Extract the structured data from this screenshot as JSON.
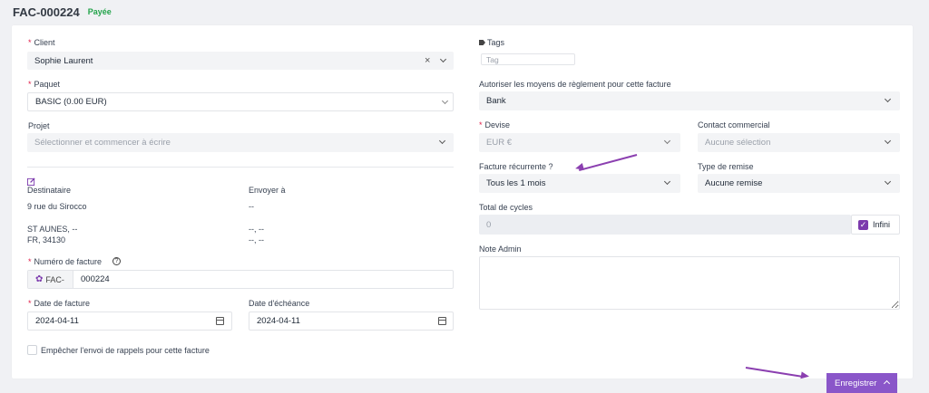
{
  "header": {
    "invoice_number": "FAC-000224",
    "status": "Payée",
    "status_color": "#22a34a"
  },
  "left": {
    "client": {
      "label": "Client",
      "value": "Sophie Laurent"
    },
    "package": {
      "label": "Paquet",
      "value": "BASIC (0.00 EUR)"
    },
    "project": {
      "label": "Projet",
      "placeholder": "Sélectionner et commencer à écrire"
    },
    "addresses": {
      "recipient_label": "Destinataire",
      "recipient_street": "9 rue du Sirocco",
      "recipient_city": "ST AUNES, --",
      "recipient_country": "FR, 34130",
      "send_to_label": "Envoyer à",
      "send_to_street": "--",
      "send_to_city": "--, --",
      "send_to_country": "--, --"
    },
    "invoice_number": {
      "label": "Numéro de facture",
      "prefix": "FAC-",
      "value": "000224"
    },
    "invoice_date": {
      "label": "Date de facture",
      "value": "2024-04-11"
    },
    "due_date": {
      "label": "Date d'échéance",
      "value": "2024-04-11"
    },
    "prevent_reminders": {
      "label": "Empêcher l'envoi de rappels pour cette facture",
      "checked": false
    }
  },
  "right": {
    "tags": {
      "label": "Tags",
      "placeholder": "Tag"
    },
    "payment_modes": {
      "label": "Autoriser les moyens de règlement pour cette facture",
      "value": "Bank"
    },
    "currency": {
      "label": "Devise",
      "value": "EUR €"
    },
    "sales_agent": {
      "label": "Contact commercial",
      "placeholder": "Aucune sélection"
    },
    "recurring": {
      "label": "Facture récurrente ?",
      "value": "Tous les 1 mois"
    },
    "discount_type": {
      "label": "Type de remise",
      "value": "Aucune remise"
    },
    "total_cycles": {
      "label": "Total de cycles",
      "value": "0",
      "infinite_label": "Infini",
      "infinite_checked": true
    },
    "admin_note": {
      "label": "Note Admin",
      "value": ""
    }
  },
  "footer": {
    "save_label": "Enregistrer"
  },
  "colors": {
    "accent": "#8a56c9",
    "annotation_arrow": "#8b3fb0",
    "required": "#e11d48"
  },
  "icons": [
    "times-icon",
    "chevron-down-icon",
    "tag-icon",
    "edit-icon",
    "help-circle-icon",
    "gear-icon",
    "calendar-icon",
    "check-icon",
    "chevron-up-icon"
  ]
}
